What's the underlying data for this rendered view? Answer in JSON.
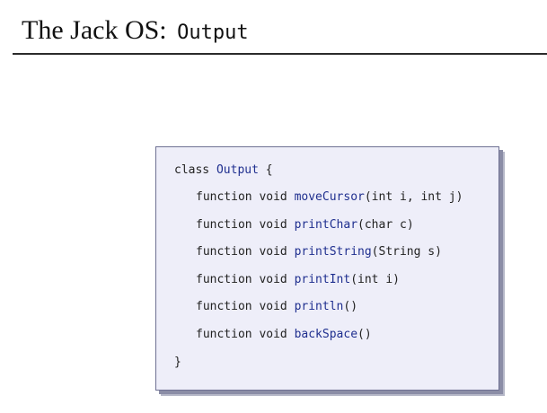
{
  "title": {
    "prefix": "The Jack OS:",
    "class_name": "Output"
  },
  "code": {
    "class_keyword": "class",
    "class_name": "Output",
    "open_brace": "{",
    "functions": [
      {
        "keyword": "function void",
        "name": "moveCursor",
        "params": "(int i, int j)"
      },
      {
        "keyword": "function void",
        "name": "printChar",
        "params": "(char c)"
      },
      {
        "keyword": "function void",
        "name": "printString",
        "params": "(String s)"
      },
      {
        "keyword": "function void",
        "name": "printInt",
        "params": "(int i)"
      },
      {
        "keyword": "function void",
        "name": "println",
        "params": "()"
      },
      {
        "keyword": "function void",
        "name": "backSpace",
        "params": "()"
      }
    ],
    "close_brace": "}"
  }
}
